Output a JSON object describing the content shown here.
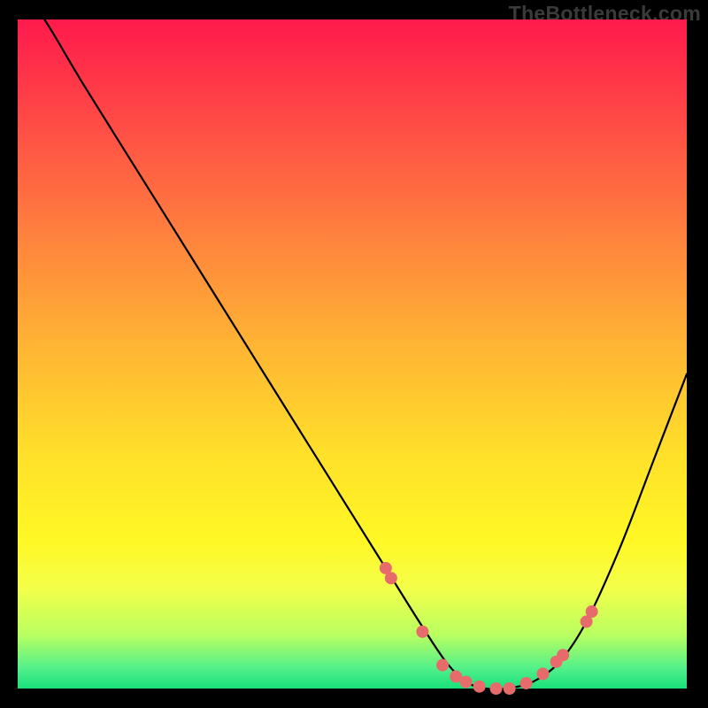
{
  "watermark": "TheBottleneck.com",
  "chart_data": {
    "type": "line",
    "title": "",
    "xlabel": "",
    "ylabel": "",
    "xlim": [
      0,
      100
    ],
    "ylim": [
      0,
      100
    ],
    "grid": false,
    "legend": false,
    "series": [
      {
        "name": "bottleneck-curve",
        "x": [
          0,
          4,
          10,
          20,
          30,
          40,
          50,
          55,
          60,
          64,
          67,
          70,
          73,
          77,
          81,
          85,
          90,
          95,
          100
        ],
        "y": [
          105,
          100,
          90,
          74,
          58,
          42,
          26,
          18,
          10,
          4,
          1,
          0,
          0,
          1,
          4,
          10,
          21,
          34,
          47
        ],
        "color": "#000000"
      }
    ],
    "markers": {
      "name": "highlighted-points",
      "color": "#e86b6b",
      "radius_px": 7,
      "x": [
        55,
        55.8,
        60.5,
        63.5,
        65.5,
        67,
        69,
        71.5,
        73.5,
        76,
        78.5,
        80.5,
        81.5,
        85,
        85.8
      ],
      "y": [
        18,
        16.5,
        8.5,
        3.5,
        1.8,
        1,
        0.3,
        0,
        0,
        0.8,
        2.2,
        4,
        5,
        10,
        11.5
      ]
    },
    "background_gradient": {
      "stops": [
        {
          "pos": 0,
          "color": "#ff1a4d"
        },
        {
          "pos": 8,
          "color": "#ff3348"
        },
        {
          "pos": 20,
          "color": "#ff5a44"
        },
        {
          "pos": 35,
          "color": "#ff8a3c"
        },
        {
          "pos": 50,
          "color": "#ffb833"
        },
        {
          "pos": 65,
          "color": "#ffe02a"
        },
        {
          "pos": 78,
          "color": "#fff825"
        },
        {
          "pos": 85,
          "color": "#f4ff4a"
        },
        {
          "pos": 92,
          "color": "#b8ff60"
        },
        {
          "pos": 97,
          "color": "#52f08a"
        },
        {
          "pos": 100,
          "color": "#18e07a"
        }
      ]
    }
  }
}
